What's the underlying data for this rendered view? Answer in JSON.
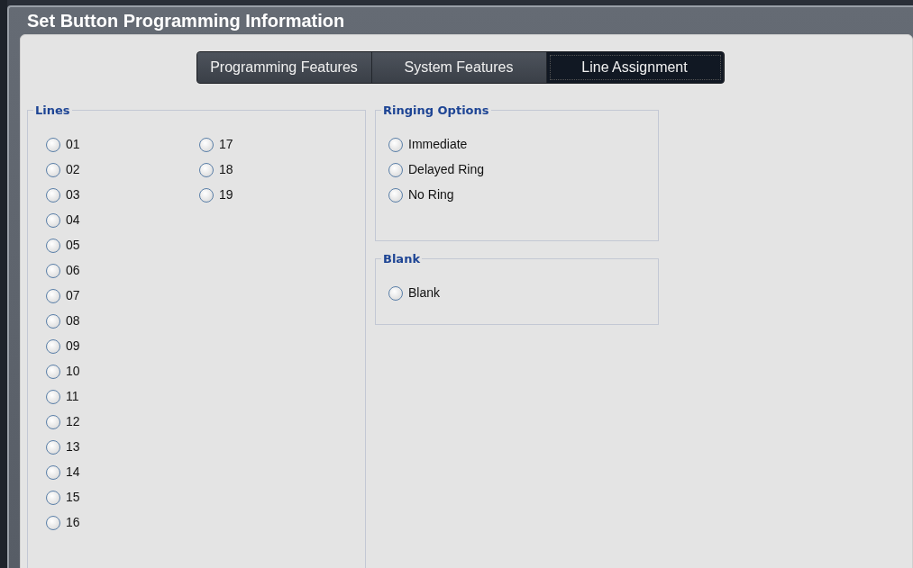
{
  "window": {
    "title": "Set Button Programming Information"
  },
  "tabs": [
    {
      "label": "Programming Features",
      "selected": false
    },
    {
      "label": "System Features",
      "selected": false
    },
    {
      "label": "Line Assignment",
      "selected": true
    }
  ],
  "lines": {
    "title": "Lines",
    "options": [
      {
        "label": "01",
        "selected": false
      },
      {
        "label": "02",
        "selected": false
      },
      {
        "label": "03",
        "selected": false
      },
      {
        "label": "04",
        "selected": false
      },
      {
        "label": "05",
        "selected": false
      },
      {
        "label": "06",
        "selected": false
      },
      {
        "label": "07",
        "selected": false
      },
      {
        "label": "08",
        "selected": false
      },
      {
        "label": "09",
        "selected": false
      },
      {
        "label": "10",
        "selected": false
      },
      {
        "label": "11",
        "selected": false
      },
      {
        "label": "12",
        "selected": false
      },
      {
        "label": "13",
        "selected": false
      },
      {
        "label": "14",
        "selected": false
      },
      {
        "label": "15",
        "selected": false
      },
      {
        "label": "16",
        "selected": false
      },
      {
        "label": "17",
        "selected": false
      },
      {
        "label": "18",
        "selected": false
      },
      {
        "label": "19",
        "selected": false
      }
    ]
  },
  "ringing_options": {
    "title": "Ringing Options",
    "options": [
      {
        "label": "Immediate",
        "selected": false
      },
      {
        "label": "Delayed Ring",
        "selected": false
      },
      {
        "label": "No Ring",
        "selected": false
      }
    ]
  },
  "blank": {
    "title": "Blank",
    "options": [
      {
        "label": "Blank",
        "selected": false
      }
    ]
  }
}
